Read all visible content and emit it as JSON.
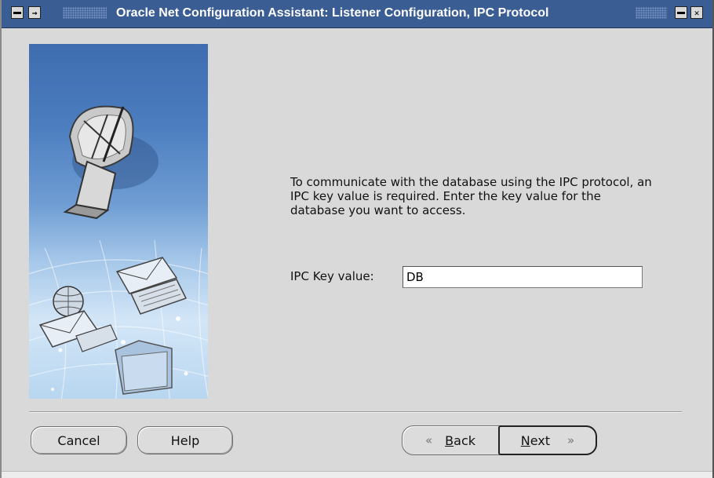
{
  "window": {
    "title": "Oracle Net Configuration Assistant: Listener Configuration, IPC Protocol"
  },
  "titlebar_icons": [
    "window-menu-icon",
    "pin-icon",
    "minimize-icon",
    "close-icon"
  ],
  "artwork": {
    "icons": [
      "satellite-dish-icon",
      "globe-icon",
      "envelope-icon",
      "keyboard-icon",
      "folder-icon"
    ]
  },
  "instructions": {
    "text": "To communicate with the database using the IPC protocol, an IPC key value is required. Enter the key value for the database you want to access."
  },
  "ipc_key": {
    "label": "IPC Key value:",
    "value": "DB"
  },
  "buttons": {
    "cancel": "Cancel",
    "help": "Help",
    "back_mnemonic": "B",
    "back_rest": "ack",
    "next_mnemonic": "N",
    "next_rest": "ext",
    "back_arrow": "«",
    "next_arrow": "»"
  },
  "colors": {
    "titlebar": "#3a5d94",
    "window_bg": "#d9d9d9",
    "art_top": "#3f6db0",
    "art_bottom": "#d3e6f7"
  }
}
